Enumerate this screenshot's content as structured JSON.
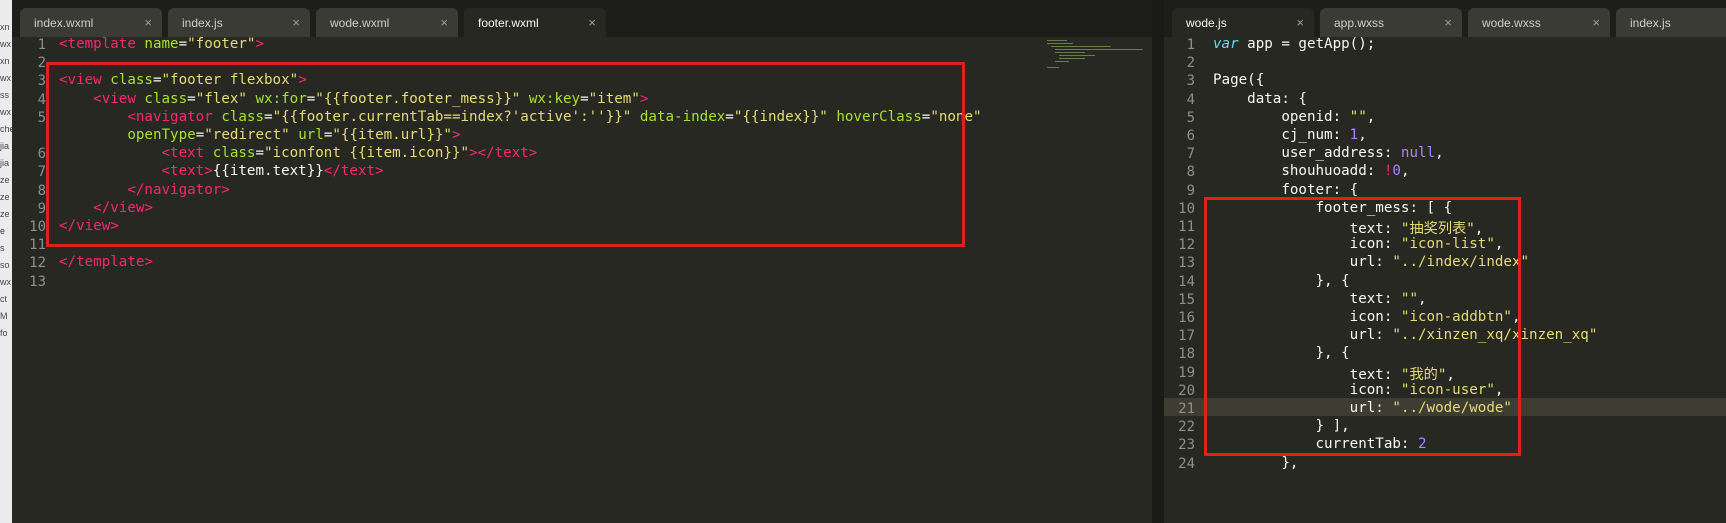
{
  "sidebar_fragments": [
    "xn",
    "wx",
    "xn",
    "wx",
    "ss",
    "wx",
    "che",
    "jia",
    "jia",
    "ze",
    "ze",
    "ze",
    "e",
    "s",
    "so",
    "wx",
    "ct",
    "M",
    "fo"
  ],
  "left": {
    "tabs": [
      {
        "label": "index.wxml",
        "active": false
      },
      {
        "label": "index.js",
        "active": false
      },
      {
        "label": "wode.wxml",
        "active": false
      },
      {
        "label": "footer.wxml",
        "active": true
      }
    ],
    "gutter": [
      "1",
      "2",
      "3",
      "4",
      "5",
      "",
      "6",
      "7",
      "8",
      "9",
      "10",
      "11",
      "12",
      "13"
    ],
    "lines": [
      [
        [
          "t",
          "<template "
        ],
        [
          "a",
          "name"
        ],
        [
          "p",
          "="
        ],
        [
          "s",
          "\"footer\""
        ],
        [
          "t",
          ">"
        ]
      ],
      [],
      [
        [
          "t",
          "<view "
        ],
        [
          "a",
          "class"
        ],
        [
          "p",
          "="
        ],
        [
          "s",
          "\"footer flexbox\""
        ],
        [
          "t",
          ">"
        ]
      ],
      [
        [
          "p",
          "    "
        ],
        [
          "t",
          "<view "
        ],
        [
          "a",
          "class"
        ],
        [
          "p",
          "="
        ],
        [
          "s",
          "\"flex\" "
        ],
        [
          "a",
          "wx:for"
        ],
        [
          "p",
          "="
        ],
        [
          "s",
          "\"{{footer.footer_mess}}\" "
        ],
        [
          "a",
          "wx:key"
        ],
        [
          "p",
          "="
        ],
        [
          "s",
          "\"item\""
        ],
        [
          "t",
          ">"
        ]
      ],
      [
        [
          "p",
          "        "
        ],
        [
          "t",
          "<navigator "
        ],
        [
          "a",
          "class"
        ],
        [
          "p",
          "="
        ],
        [
          "s",
          "\"{{footer.currentTab==index?'active':''}}\" "
        ],
        [
          "a",
          "data-index"
        ],
        [
          "p",
          "="
        ],
        [
          "s",
          "\"{{index}}\" "
        ],
        [
          "a",
          "hoverClass"
        ],
        [
          "p",
          "="
        ],
        [
          "s",
          "\"none\""
        ]
      ],
      [
        [
          "p",
          "        "
        ],
        [
          "a",
          "openType"
        ],
        [
          "p",
          "="
        ],
        [
          "s",
          "\"redirect\" "
        ],
        [
          "a",
          "url"
        ],
        [
          "p",
          "="
        ],
        [
          "s",
          "\"{{item.url}}\""
        ],
        [
          "t",
          ">"
        ]
      ],
      [
        [
          "p",
          "            "
        ],
        [
          "t",
          "<text "
        ],
        [
          "a",
          "class"
        ],
        [
          "p",
          "="
        ],
        [
          "s",
          "\"iconfont {{item.icon}}\""
        ],
        [
          "t",
          "></text>"
        ]
      ],
      [
        [
          "p",
          "            "
        ],
        [
          "t",
          "<text>"
        ],
        [
          "p",
          "{{item.text}}"
        ],
        [
          "t",
          "</text>"
        ]
      ],
      [
        [
          "p",
          "        "
        ],
        [
          "t",
          "</navigator>"
        ]
      ],
      [
        [
          "p",
          "    "
        ],
        [
          "t",
          "</view>"
        ]
      ],
      [
        [
          "t",
          "</view>"
        ]
      ],
      [],
      [
        [
          "t",
          "</template>"
        ]
      ],
      []
    ]
  },
  "right": {
    "tabs": [
      {
        "label": "wode.js",
        "active": true
      },
      {
        "label": "app.wxss",
        "active": false
      },
      {
        "label": "wode.wxss",
        "active": false
      },
      {
        "label": "index.js",
        "active": false
      }
    ],
    "gutter": [
      "1",
      "2",
      "3",
      "4",
      "5",
      "6",
      "7",
      "8",
      "9",
      "10",
      "11",
      "12",
      "13",
      "14",
      "15",
      "16",
      "17",
      "18",
      "19",
      "20",
      "21",
      "22",
      "23",
      "24"
    ],
    "lines": [
      [
        [
          "kw",
          "var "
        ],
        [
          "p",
          "app = "
        ],
        [
          "f",
          "getApp"
        ],
        [
          "p",
          "();"
        ]
      ],
      [],
      [
        [
          "p",
          "Page({"
        ]
      ],
      [
        [
          "p",
          "    data: {"
        ]
      ],
      [
        [
          "p",
          "        openid: "
        ],
        [
          "s",
          "\"\""
        ],
        [
          "p",
          ","
        ]
      ],
      [
        [
          "p",
          "        cj_num: "
        ],
        [
          "n",
          "1"
        ],
        [
          "p",
          ","
        ]
      ],
      [
        [
          "p",
          "        user_address: "
        ],
        [
          "n",
          "null"
        ],
        [
          "p",
          ","
        ]
      ],
      [
        [
          "p",
          "        shouhuoadd: "
        ],
        [
          "t",
          "!"
        ],
        [
          "n",
          "0"
        ],
        [
          "p",
          ","
        ]
      ],
      [
        [
          "p",
          "        footer: {"
        ]
      ],
      [
        [
          "p",
          "            footer_mess: [ {"
        ]
      ],
      [
        [
          "p",
          "                text: "
        ],
        [
          "s",
          "\"抽奖列表\""
        ],
        [
          "p",
          ","
        ]
      ],
      [
        [
          "p",
          "                icon: "
        ],
        [
          "s",
          "\"icon-list\""
        ],
        [
          "p",
          ","
        ]
      ],
      [
        [
          "p",
          "                url: "
        ],
        [
          "s",
          "\"../index/index\""
        ]
      ],
      [
        [
          "p",
          "            }, {"
        ]
      ],
      [
        [
          "p",
          "                text: "
        ],
        [
          "s",
          "\"\""
        ],
        [
          "p",
          ","
        ]
      ],
      [
        [
          "p",
          "                icon: "
        ],
        [
          "s",
          "\"icon-addbtn\""
        ],
        [
          "p",
          ","
        ]
      ],
      [
        [
          "p",
          "                url: "
        ],
        [
          "s",
          "\"../xinzen_xq/xinzen_xq\""
        ]
      ],
      [
        [
          "p",
          "            }, {"
        ]
      ],
      [
        [
          "p",
          "                text: "
        ],
        [
          "s",
          "\"我的\""
        ],
        [
          "p",
          ","
        ]
      ],
      [
        [
          "p",
          "                icon: "
        ],
        [
          "s",
          "\"icon-user\""
        ],
        [
          "p",
          ","
        ]
      ],
      [
        [
          "p",
          "                url: "
        ],
        [
          "s",
          "\"../wode/wode\""
        ]
      ],
      [
        [
          "p",
          "            } ],"
        ]
      ],
      [
        [
          "p",
          "            currentTab: "
        ],
        [
          "n",
          "2"
        ]
      ],
      [
        [
          "p",
          "        },"
        ]
      ]
    ]
  },
  "colors": {
    "highlight_box": "#e0201c",
    "editor_bg": "#272822"
  }
}
